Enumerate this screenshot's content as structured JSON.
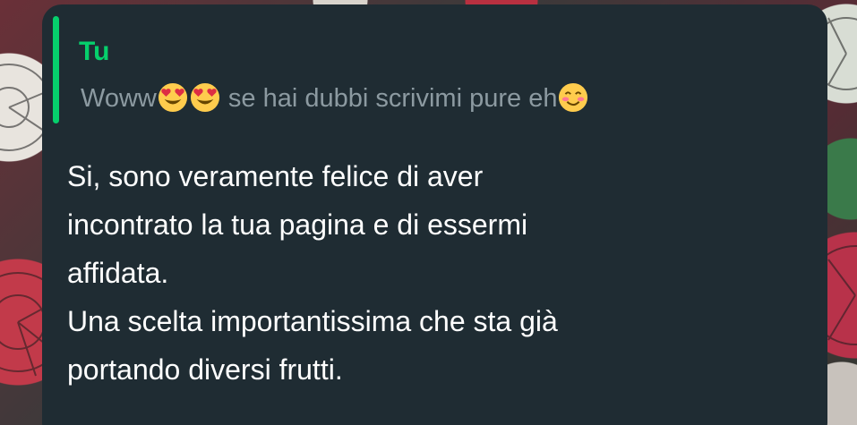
{
  "reply": {
    "author": "Tu",
    "text_before": "Woww",
    "emojis_1": [
      "smiling-face-with-heart-eyes",
      "smiling-face-with-heart-eyes"
    ],
    "text_middle": " se hai dubbi scrivimi pure eh",
    "emojis_2": [
      "smiling-face-with-smiling-eyes"
    ]
  },
  "message": {
    "line1": "Si, sono veramente felice di aver",
    "line2": "incontrato la tua pagina e di essermi",
    "line3": "affidata.",
    "line4": "Una scelta importantissima che sta già",
    "line5": "portando diversi frutti."
  },
  "colors": {
    "bubble_bg": "#1f2c33",
    "quote_accent": "#06cf6c",
    "quote_text": "#8c9aa1",
    "message_text": "#ffffff"
  }
}
